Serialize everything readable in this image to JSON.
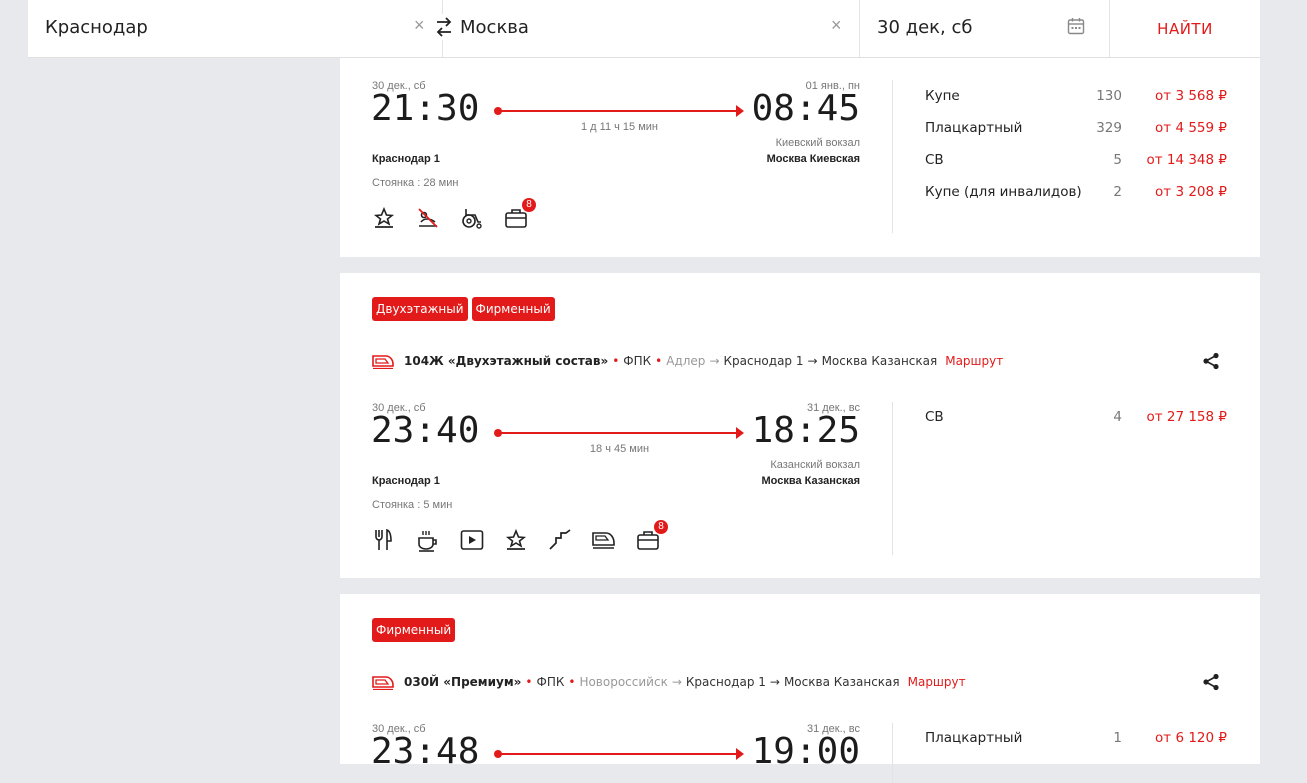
{
  "search": {
    "from": "Краснодар",
    "to": "Москва",
    "date": "30 дек, сб",
    "find_label": "НАЙТИ",
    "clear_glyph": "×"
  },
  "icons": [
    "swap-icon",
    "calendar-icon",
    "clear-icon",
    "train-icon",
    "share-icon",
    "premium-icon",
    "no-bedding-icon",
    "wheelchair-icon",
    "luggage-icon",
    "restaurant-icon",
    "coffee-icon",
    "video-icon",
    "stairs-icon",
    "train-type-icon"
  ],
  "colors": {
    "accent": "#e21a1a",
    "background": "#e8e9ec"
  },
  "trains": [
    {
      "dep_date": "30 дек., сб",
      "dep_time": "21:30",
      "arr_date": "01 янв., пн",
      "arr_time": "08:45",
      "duration": "1 д 11 ч 15 мин",
      "dep_station": "Краснодар 1",
      "arr_terminal": "Киевский вокзал",
      "arr_station": "Москва Киевская",
      "stop": "Стоянка : 28 мин",
      "luggage_count": "8",
      "prices": [
        {
          "cls": "Купе",
          "count": "130",
          "price": "от 3 568 ₽"
        },
        {
          "cls": "Плацкартный",
          "count": "329",
          "price": "от 4 559 ₽"
        },
        {
          "cls": "СВ",
          "count": "5",
          "price": "от 14 348 ₽"
        },
        {
          "cls": "Купе (для инвалидов)",
          "count": "2",
          "price": "от 3 208 ₽"
        }
      ]
    },
    {
      "tags": [
        "Двухэтажный",
        "Фирменный"
      ],
      "number": "104Ж «Двухэтажный состав»",
      "carrier": "ФПК",
      "origin": "Адлер",
      "from": "Краснодар 1",
      "to": "Москва Казанская",
      "route_label": "Маршрут",
      "dep_date": "30 дек., сб",
      "dep_time": "23:40",
      "arr_date": "31 дек., вс",
      "arr_time": "18:25",
      "duration": "18 ч 45 мин",
      "dep_station": "Краснодар 1",
      "arr_terminal": "Казанский вокзал",
      "arr_station": "Москва Казанская",
      "stop": "Стоянка : 5 мин",
      "luggage_count": "8",
      "prices": [
        {
          "cls": "СВ",
          "count": "4",
          "price": "от 27 158 ₽"
        }
      ]
    },
    {
      "tags": [
        "Фирменный"
      ],
      "number": "030Й «Премиум»",
      "carrier": "ФПК",
      "origin": "Новороссийск",
      "from": "Краснодар 1",
      "to": "Москва Казанская",
      "route_label": "Маршрут",
      "dep_date": "30 дек., сб",
      "dep_time": "23:48",
      "arr_date": "31 дек., вс",
      "arr_time": "19:00",
      "prices": [
        {
          "cls": "Плацкартный",
          "count": "1",
          "price": "от 6 120 ₽"
        }
      ]
    }
  ]
}
